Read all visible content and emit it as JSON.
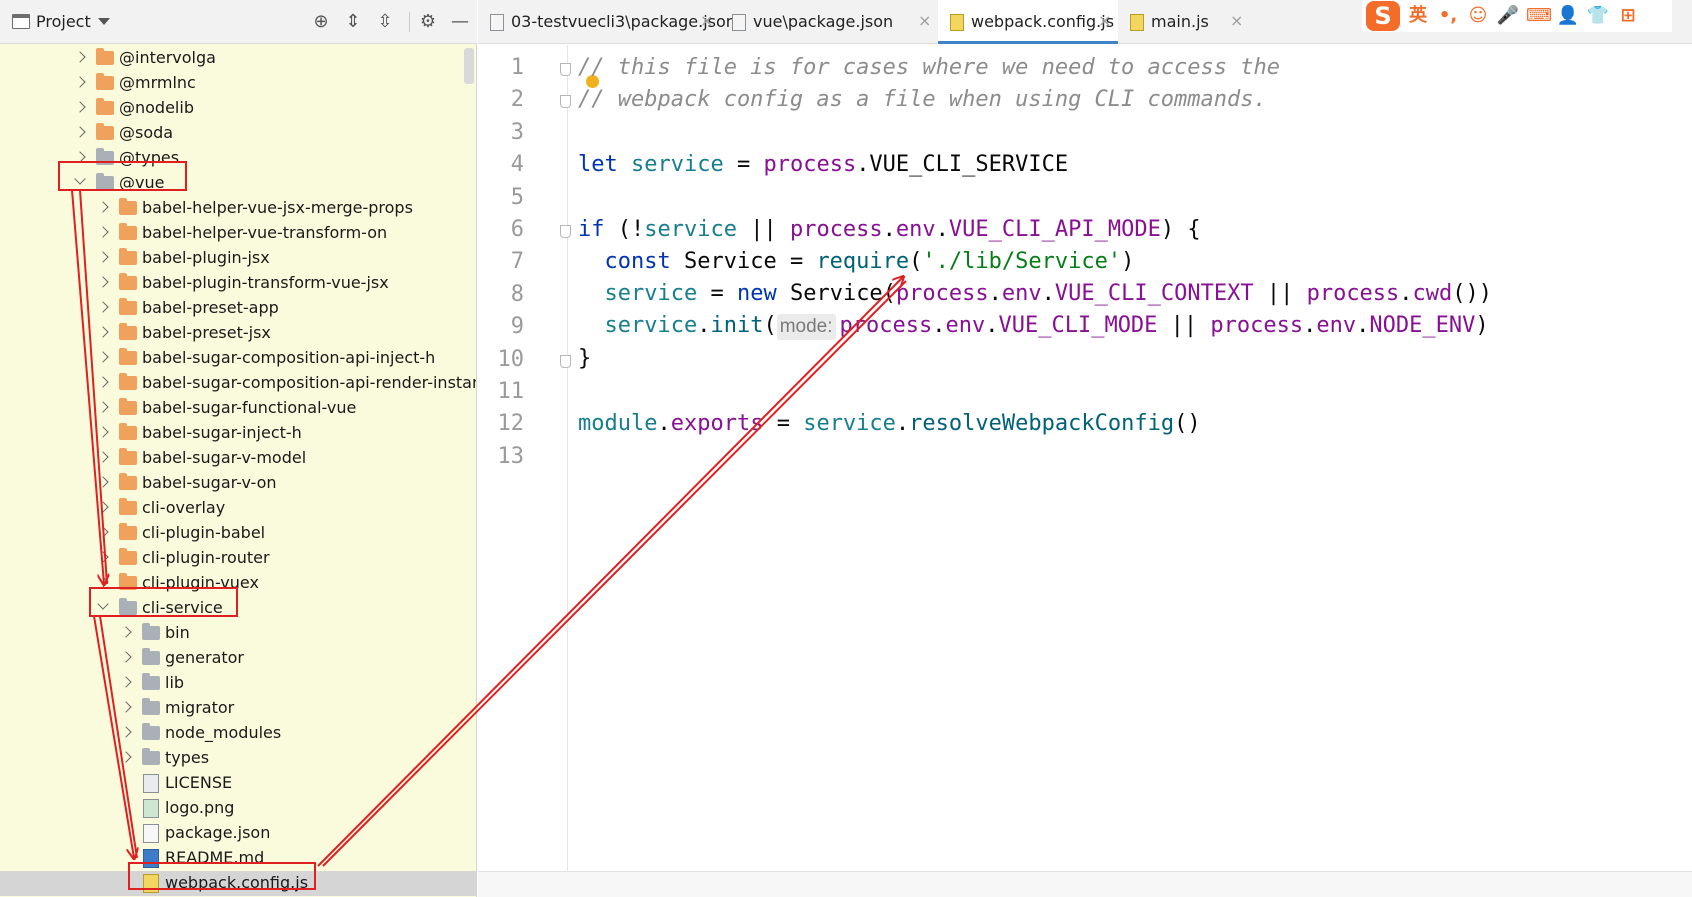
{
  "project_panel": {
    "title": "Project",
    "tree": [
      {
        "label": "@intervolga",
        "type": "folder",
        "color": "orange",
        "depth": 0,
        "state": "collapsed"
      },
      {
        "label": "@mrmlnc",
        "type": "folder",
        "color": "orange",
        "depth": 0,
        "state": "collapsed"
      },
      {
        "label": "@nodelib",
        "type": "folder",
        "color": "orange",
        "depth": 0,
        "state": "collapsed"
      },
      {
        "label": "@soda",
        "type": "folder",
        "color": "orange",
        "depth": 0,
        "state": "collapsed"
      },
      {
        "label": "@types",
        "type": "folder",
        "color": "grey",
        "depth": 0,
        "state": "collapsed"
      },
      {
        "label": "@vue",
        "type": "folder",
        "color": "grey",
        "depth": 0,
        "state": "expanded"
      },
      {
        "label": "babel-helper-vue-jsx-merge-props",
        "type": "folder",
        "color": "orange",
        "depth": 1,
        "state": "collapsed"
      },
      {
        "label": "babel-helper-vue-transform-on",
        "type": "folder",
        "color": "orange",
        "depth": 1,
        "state": "collapsed"
      },
      {
        "label": "babel-plugin-jsx",
        "type": "folder",
        "color": "orange",
        "depth": 1,
        "state": "collapsed"
      },
      {
        "label": "babel-plugin-transform-vue-jsx",
        "type": "folder",
        "color": "orange",
        "depth": 1,
        "state": "collapsed"
      },
      {
        "label": "babel-preset-app",
        "type": "folder",
        "color": "orange",
        "depth": 1,
        "state": "collapsed"
      },
      {
        "label": "babel-preset-jsx",
        "type": "folder",
        "color": "orange",
        "depth": 1,
        "state": "collapsed"
      },
      {
        "label": "babel-sugar-composition-api-inject-h",
        "type": "folder",
        "color": "orange",
        "depth": 1,
        "state": "collapsed"
      },
      {
        "label": "babel-sugar-composition-api-render-instance",
        "type": "folder",
        "color": "orange",
        "depth": 1,
        "state": "collapsed"
      },
      {
        "label": "babel-sugar-functional-vue",
        "type": "folder",
        "color": "orange",
        "depth": 1,
        "state": "collapsed"
      },
      {
        "label": "babel-sugar-inject-h",
        "type": "folder",
        "color": "orange",
        "depth": 1,
        "state": "collapsed"
      },
      {
        "label": "babel-sugar-v-model",
        "type": "folder",
        "color": "orange",
        "depth": 1,
        "state": "collapsed"
      },
      {
        "label": "babel-sugar-v-on",
        "type": "folder",
        "color": "orange",
        "depth": 1,
        "state": "collapsed"
      },
      {
        "label": "cli-overlay",
        "type": "folder",
        "color": "orange",
        "depth": 1,
        "state": "collapsed"
      },
      {
        "label": "cli-plugin-babel",
        "type": "folder",
        "color": "orange",
        "depth": 1,
        "state": "collapsed"
      },
      {
        "label": "cli-plugin-router",
        "type": "folder",
        "color": "orange",
        "depth": 1,
        "state": "collapsed"
      },
      {
        "label": "cli-plugin-vuex",
        "type": "folder",
        "color": "orange",
        "depth": 1,
        "state": "collapsed"
      },
      {
        "label": "cli-service",
        "type": "folder",
        "color": "grey",
        "depth": 1,
        "state": "expanded"
      },
      {
        "label": "bin",
        "type": "folder",
        "color": "grey",
        "depth": 2,
        "state": "collapsed"
      },
      {
        "label": "generator",
        "type": "folder",
        "color": "grey",
        "depth": 2,
        "state": "collapsed"
      },
      {
        "label": "lib",
        "type": "folder",
        "color": "grey",
        "depth": 2,
        "state": "collapsed"
      },
      {
        "label": "migrator",
        "type": "folder",
        "color": "grey",
        "depth": 2,
        "state": "collapsed"
      },
      {
        "label": "node_modules",
        "type": "folder",
        "color": "grey",
        "depth": 2,
        "state": "collapsed"
      },
      {
        "label": "types",
        "type": "folder",
        "color": "grey",
        "depth": 2,
        "state": "collapsed"
      },
      {
        "label": "LICENSE",
        "type": "file",
        "icon": "license",
        "depth": 2
      },
      {
        "label": "logo.png",
        "type": "file",
        "icon": "image",
        "depth": 2
      },
      {
        "label": "package.json",
        "type": "file",
        "icon": "json",
        "depth": 2
      },
      {
        "label": "README.md",
        "type": "file",
        "icon": "md",
        "depth": 2
      },
      {
        "label": "webpack.config.js",
        "type": "file",
        "icon": "js",
        "depth": 2,
        "selected": true
      }
    ]
  },
  "tabs": [
    {
      "label": "03-testvuecli3\\package.json",
      "icon": "json",
      "active": false
    },
    {
      "label": "vue\\package.json",
      "icon": "json",
      "active": false
    },
    {
      "label": "webpack.config.js",
      "icon": "js",
      "active": true
    },
    {
      "label": "main.js",
      "icon": "js",
      "active": false
    }
  ],
  "tab_close_glyph": "×",
  "ime": {
    "logo": "S",
    "mode": "英",
    "punct": "•,"
  },
  "editor": {
    "line_numbers": [
      "1",
      "2",
      "3",
      "4",
      "5",
      "6",
      "7",
      "8",
      "9",
      "10",
      "11",
      "12",
      "13"
    ],
    "code": {
      "l1": "// this file is for cases where we need to access the",
      "l2": "// webpack config as a file when using CLI commands.",
      "l4_kw": "let",
      "l4_var": "service",
      "l4_eq": " = ",
      "l4_obj": "process",
      "l4_rest": ".VUE_CLI_SERVICE",
      "l6_kw": "if",
      "l6_a": " (!",
      "l6_var": "service",
      "l6_b": " || ",
      "l6_obj": "process",
      "l6_dot": ".",
      "l6_env": "env",
      "l6_dot2": ".",
      "l6_prop": "VUE_CLI_API_MODE",
      "l6_end": ") {",
      "l7_kw": "const",
      "l7_a": " Service = ",
      "l7_fn": "require",
      "l7_p1": "(",
      "l7_str": "'./lib/Service'",
      "l7_p2": ")",
      "l8_var": "service",
      "l8_a": " = ",
      "l8_kw": "new",
      "l8_b": " Service(",
      "l8_obj": "process",
      "l8_d1": ".",
      "l8_env": "env",
      "l8_d2": ".",
      "l8_prop": "VUE_CLI_CONTEXT",
      "l8_or": " || ",
      "l8_obj2": "process",
      "l8_d3": ".",
      "l8_fn": "cwd",
      "l8_end": "())",
      "l9_var": "service",
      "l9_d": ".",
      "l9_fn": "init",
      "l9_p": "(",
      "l9_hint": "mode:",
      "l9_obj": "process",
      "l9_d1": ".",
      "l9_env": "env",
      "l9_d2": ".",
      "l9_prop": "VUE_CLI_MODE",
      "l9_or": " || ",
      "l9_obj2": "process",
      "l9_d3": ".",
      "l9_env2": "env",
      "l9_d4": ".",
      "l9_prop2": "NODE_ENV",
      "l9_end": ")",
      "l10": "}",
      "l12_var": "module",
      "l12_d": ".",
      "l12_prop": "exports",
      "l12_eq": " = ",
      "l12_var2": "service",
      "l12_d2": ".",
      "l12_fn": "resolveWebpackConfig",
      "l12_end": "()"
    }
  },
  "colors": {
    "annotation_red": "#e02020",
    "tree_background": "#fafadc",
    "active_tab_underline": "#4083c9"
  }
}
